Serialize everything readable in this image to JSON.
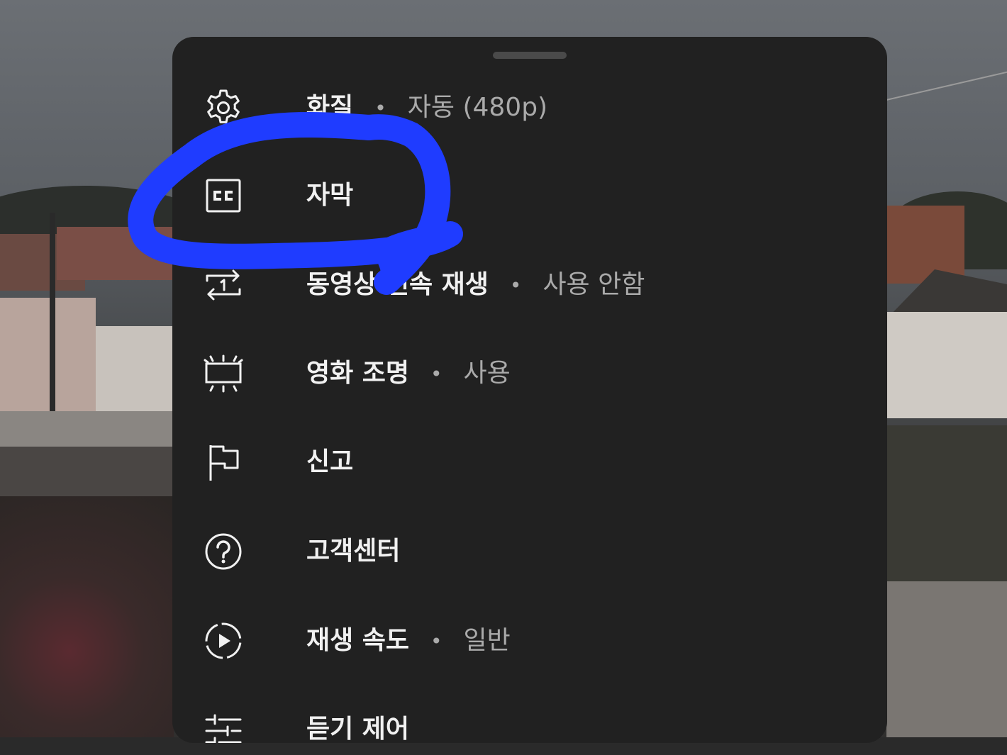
{
  "menu": {
    "items": [
      {
        "icon": "gear-icon",
        "label": "화질",
        "value": "자동 (480p)"
      },
      {
        "icon": "closed-captions-icon",
        "label": "자막",
        "value": ""
      },
      {
        "icon": "repeat-one-icon",
        "label": "동영상 연속 재생",
        "value": "사용 안함"
      },
      {
        "icon": "ambient-mode-icon",
        "label": "영화 조명",
        "value": "사용"
      },
      {
        "icon": "flag-icon",
        "label": "신고",
        "value": ""
      },
      {
        "icon": "help-circle-icon",
        "label": "고객센터",
        "value": ""
      },
      {
        "icon": "playback-speed-icon",
        "label": "재생 속도",
        "value": "일반"
      },
      {
        "icon": "audio-controls-icon",
        "label": "듣기 제어",
        "value": ""
      }
    ],
    "separator": "•"
  },
  "annotation": {
    "type": "hand-drawn circle",
    "target": "자막",
    "color": "#1f3cff"
  },
  "colors": {
    "sheet_background": "#212121",
    "primary_text": "#f1f1f1",
    "secondary_text": "#aaaaaa"
  }
}
